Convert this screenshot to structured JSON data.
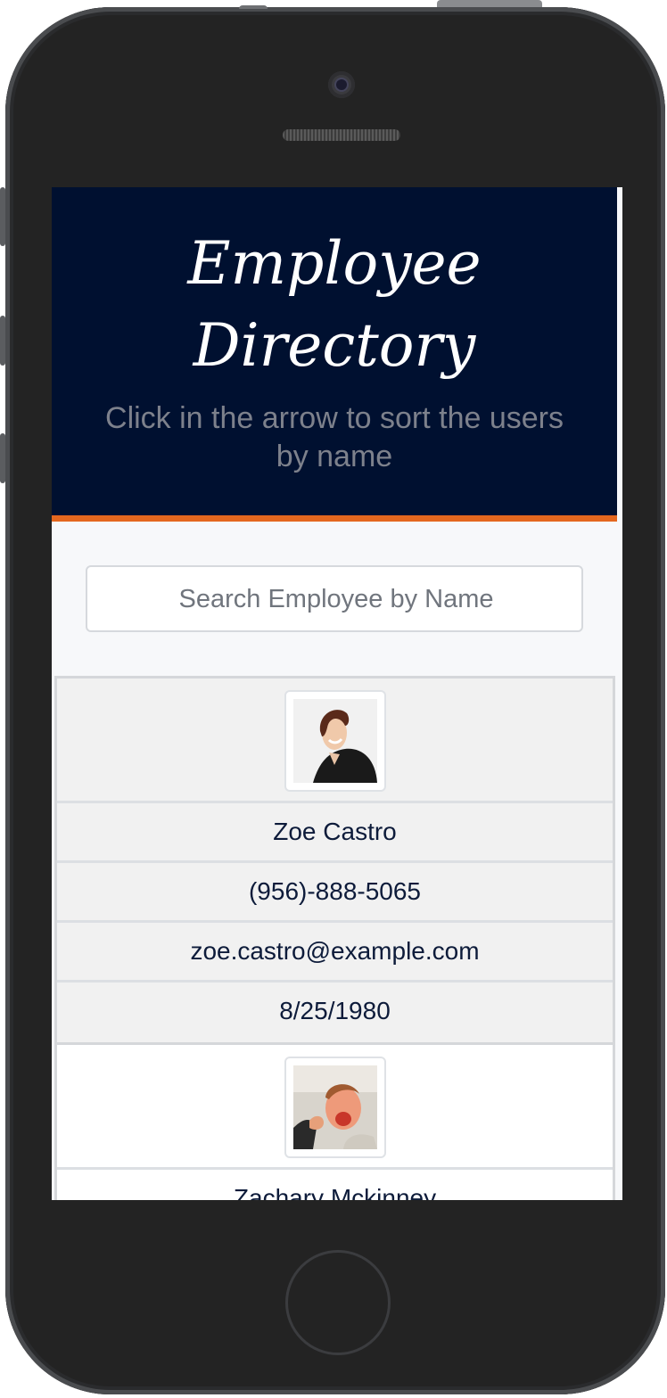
{
  "header": {
    "title": "Employee Directory",
    "subtitle": "Click in the arrow to sort the users by name"
  },
  "search": {
    "placeholder": "Search Employee by Name",
    "value": ""
  },
  "employees": [
    {
      "name": "Zoe Castro",
      "phone": "(956)-888-5065",
      "email": "zoe.castro@example.com",
      "dob": "8/25/1980",
      "avatar_icon": "avatar-woman-photo"
    },
    {
      "name": "Zachary Mckinney",
      "phone": "",
      "email": "",
      "dob": "",
      "avatar_icon": "avatar-man-photo"
    }
  ],
  "colors": {
    "header_bg": "#001030",
    "header_accent": "#e4671f",
    "row_odd_bg": "#f1f1f1",
    "row_even_bg": "#ffffff",
    "text": "#0d1b3a"
  }
}
